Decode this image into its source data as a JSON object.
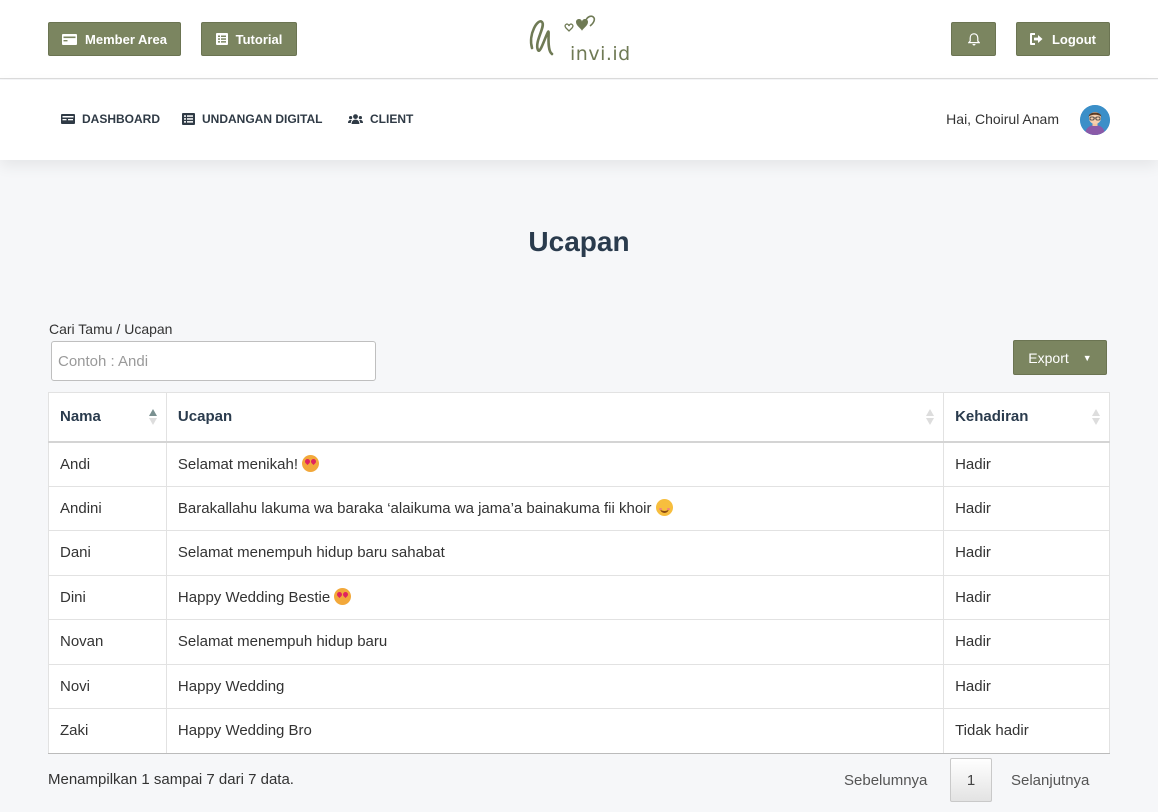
{
  "header": {
    "member_area": "Member Area",
    "tutorial": "Tutorial",
    "logo_text": "invi.id",
    "logout": "Logout"
  },
  "nav": {
    "dashboard": "DASHBOARD",
    "undangan": "UNDANGAN DIGITAL",
    "client": "CLIENT",
    "greeting": "Hai, Choirul Anam"
  },
  "page": {
    "title": "Ucapan"
  },
  "search": {
    "label": "Cari Tamu / Ucapan",
    "placeholder": "Contoh : Andi",
    "value": ""
  },
  "export": {
    "label": "Export"
  },
  "table": {
    "headers": [
      "Nama",
      "Ucapan",
      "Kehadiran"
    ],
    "rows": [
      {
        "nama": "Andi",
        "ucapan": "Selamat menikah!",
        "emoji": "heart-eyes",
        "kehadiran": "Hadir"
      },
      {
        "nama": "Andini",
        "ucapan": "Barakallahu lakuma wa baraka ‘alaikuma wa jama’a bainakuma fii khoir",
        "emoji": "smile",
        "kehadiran": "Hadir"
      },
      {
        "nama": "Dani",
        "ucapan": "Selamat menempuh hidup baru sahabat",
        "emoji": "",
        "kehadiran": "Hadir"
      },
      {
        "nama": "Dini",
        "ucapan": "Happy Wedding Bestie",
        "emoji": "heart-eyes",
        "kehadiran": "Hadir"
      },
      {
        "nama": "Novan",
        "ucapan": "Selamat menempuh hidup baru",
        "emoji": "",
        "kehadiran": "Hadir"
      },
      {
        "nama": "Novi",
        "ucapan": "Happy Wedding",
        "emoji": "",
        "kehadiran": "Hadir"
      },
      {
        "nama": "Zaki",
        "ucapan": "Happy Wedding Bro",
        "emoji": "",
        "kehadiran": "Tidak hadir"
      }
    ]
  },
  "footer": {
    "info": "Menampilkan 1 sampai 7 dari 7 data.",
    "prev": "Sebelumnya",
    "page": "1",
    "next": "Selanjutnya"
  },
  "colors": {
    "accent": "#7b8560",
    "title": "#2a3b4d",
    "background": "#f6f7f9"
  }
}
